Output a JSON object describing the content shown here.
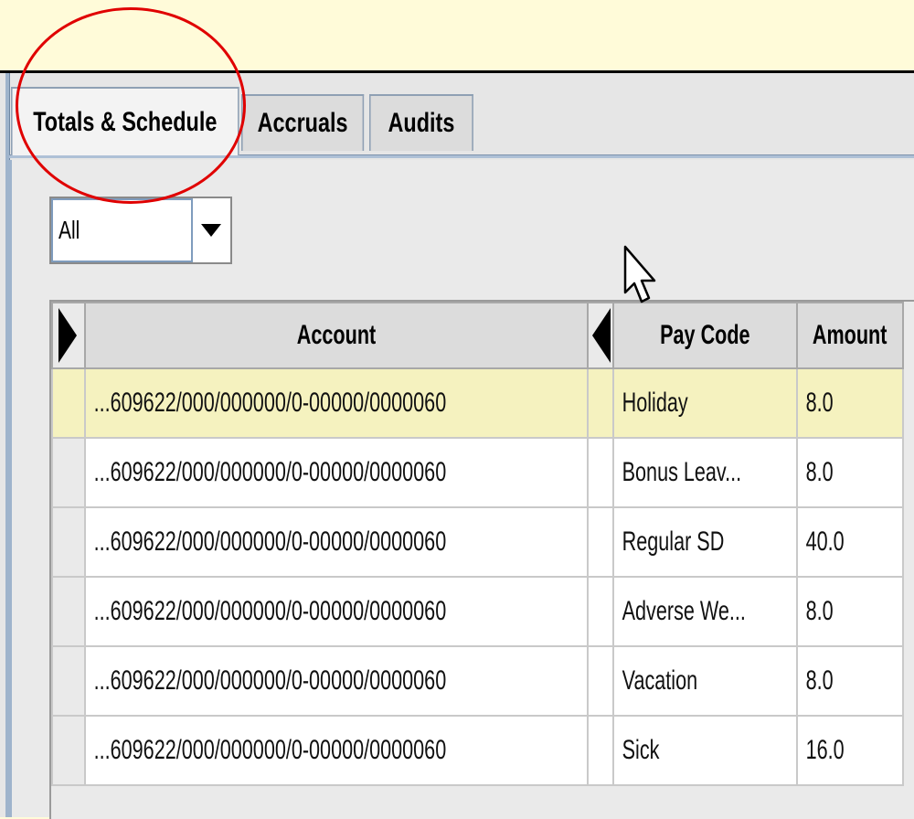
{
  "tabs": [
    {
      "label": "Totals & Schedule",
      "active": true
    },
    {
      "label": "Accruals",
      "active": false
    },
    {
      "label": "Audits",
      "active": false
    }
  ],
  "filter": {
    "selected": "All"
  },
  "table": {
    "columns": [
      "Account",
      "Pay Code",
      "Amount"
    ],
    "rows": [
      {
        "account": "...609622/000/000000/0-00000/0000060",
        "pay_code": "Holiday",
        "amount": "8.0",
        "selected": true
      },
      {
        "account": "...609622/000/000000/0-00000/0000060",
        "pay_code": "Bonus Leav...",
        "amount": "8.0"
      },
      {
        "account": "...609622/000/000000/0-00000/0000060",
        "pay_code": "Regular SD",
        "amount": "40.0"
      },
      {
        "account": "...609622/000/000000/0-00000/0000060",
        "pay_code": "Adverse We...",
        "amount": "8.0"
      },
      {
        "account": "...609622/000/000000/0-00000/0000060",
        "pay_code": "Vacation",
        "amount": "8.0"
      },
      {
        "account": "...609622/000/000000/0-00000/0000060",
        "pay_code": "Sick",
        "amount": "16.0"
      }
    ]
  },
  "colors": {
    "background": "#fffbd9",
    "selected_row": "#f5f2bf",
    "annotation": "#e00000"
  },
  "icons": {
    "dropdown": "caret-down-icon",
    "cursor": "mouse-pointer-icon",
    "expand_left": "triangle-right-icon",
    "expand_right": "triangle-left-icon"
  }
}
